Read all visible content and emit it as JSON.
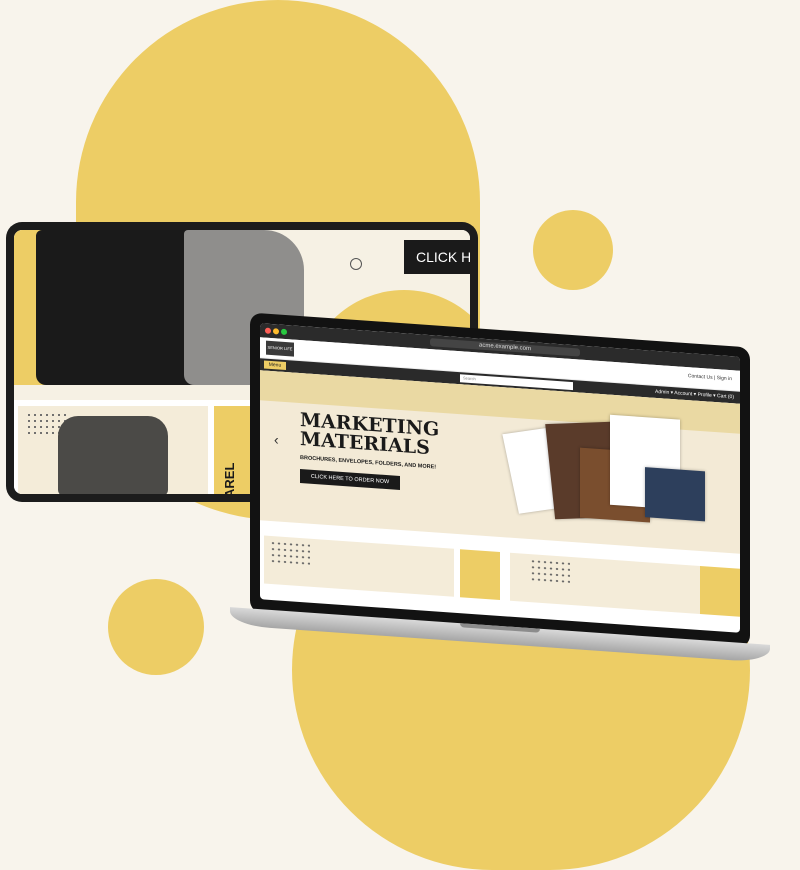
{
  "colors": {
    "background": "#f8f4ec",
    "accent": "#edcd65",
    "dark": "#1a1a1a"
  },
  "tablet": {
    "cta_text": "CLICK HER",
    "vertical_label": "AREL"
  },
  "laptop": {
    "url_text": "acme.example.com",
    "top_links": "Contact Us  |  Sign in",
    "menu_label": "Menu",
    "search_placeholder": "Search",
    "nav_links": "Admin ▾   Account ▾   Profile ▾   Cart (0)",
    "hero": {
      "title": "MARKETING\nMATERIALS",
      "subtitle": "BROCHURES, ENVELOPES, FOLDERS, AND MORE!",
      "cta": "CLICK HERE TO ORDER NOW",
      "prev_arrow": "‹"
    },
    "logo_text": "SENIOR LIFE"
  }
}
